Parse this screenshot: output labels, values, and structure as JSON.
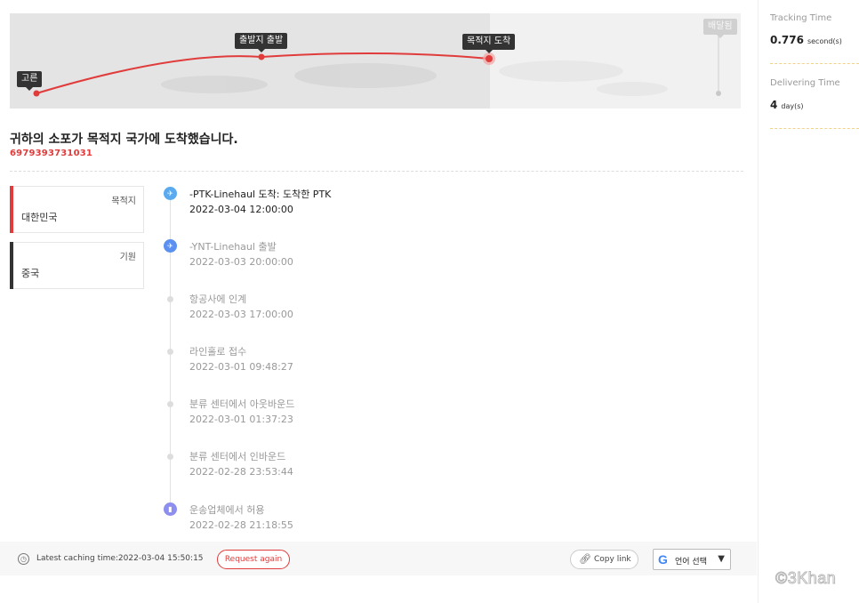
{
  "map": {
    "origin_label": "고른",
    "departure_label": "출발지 출발",
    "arrival_label": "목적지 도착",
    "delivered_label": "배달됨",
    "route_color": "#e03c3c"
  },
  "side": {
    "tracking_label": "Tracking Time",
    "tracking_value": "0.776",
    "tracking_unit": "second(s)",
    "delivering_label": "Delivering Time",
    "delivering_value": "4",
    "delivering_unit": "day(s)"
  },
  "status": {
    "headline": "귀하의 소포가 목적지 국가에 도착했습니다.",
    "tracking_number": "6979393731031"
  },
  "countries": [
    {
      "role": "목적지",
      "name": "대한민국",
      "bar_color": "#e03c3c"
    },
    {
      "role": "기원",
      "name": "중국",
      "bar_color": "#333333"
    }
  ],
  "events": [
    {
      "title": "-PTK-Linehaul 도착: 도착한 PTK",
      "date": "2022-03-04 12:00:00",
      "icon": "plane-landing-icon",
      "icon_color": "#5aaaf0"
    },
    {
      "title": "-YNT-Linehaul 출발",
      "date": "2022-03-03 20:00:00",
      "icon": "plane-takeoff-icon",
      "icon_color": "#5b8ff0"
    },
    {
      "title": "항공사에 인계",
      "date": "2022-03-03 17:00:00",
      "icon": "dot-icon"
    },
    {
      "title": "라인홀로 접수",
      "date": "2022-03-01 09:48:27",
      "icon": "dot-icon"
    },
    {
      "title": "분류 센터에서 아웃바운드",
      "date": "2022-03-01 01:37:23",
      "icon": "dot-icon"
    },
    {
      "title": "분류 센터에서 인바운드",
      "date": "2022-02-28 23:53:44",
      "icon": "dot-icon"
    },
    {
      "title": "운송업체에서 허용",
      "date": "2022-02-28 21:18:55",
      "icon": "truck-icon",
      "icon_color": "#8e8ef0"
    }
  ],
  "footer": {
    "cache_text": "Latest caching time:2022-03-04 15:50:15",
    "request_again": "Request again",
    "copy_link": "Copy link",
    "language": "언어 선택"
  },
  "watermark": "©3Khan"
}
